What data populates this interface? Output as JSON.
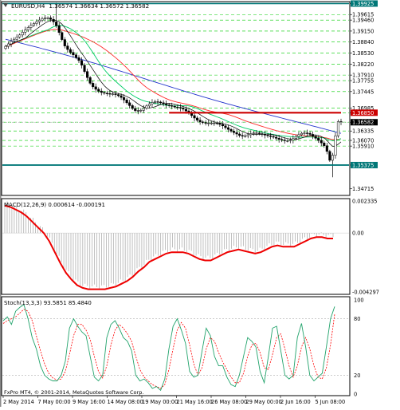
{
  "header": {
    "symbol_tf": "EURUSD,H4",
    "ohlc": "1.36574 1.36634 1.36572 1.36582"
  },
  "macd_label": "MACD(12,26,9) 0.000614 -0.000191",
  "stoch_label": "Stoch(13,3,3) 93.5851 85.4840",
  "footer": "FxPro MT4, © 2001-2014, MetaQuotes Software Corp.",
  "price_axis": {
    "ticks": [
      "1.39925",
      "1.39615",
      "1.39460",
      "1.39150",
      "1.38840",
      "1.38530",
      "1.38220",
      "1.37910",
      "1.37755",
      "1.37445",
      "1.36985",
      "1.36850",
      "1.36582",
      "1.36335",
      "1.36070",
      "1.35910",
      "1.35375",
      "1.34715"
    ]
  },
  "macd_axis": {
    "ticks": [
      "0.002335",
      "0.00",
      "-0.004297"
    ]
  },
  "stoch_axis": {
    "ticks": [
      "100",
      "80",
      "20",
      "0"
    ]
  },
  "time_axis": {
    "labels": [
      "2 May 2014",
      "7 May 00:00",
      "9 May 16:00",
      "14 May 08:00",
      "19 May 00:00",
      "21 May 16:00",
      "26 May 08:00",
      "29 May 00:00",
      "2 Jun 16:00",
      "5 Jun 08:00"
    ]
  },
  "levels": {
    "resistance": 1.3685,
    "support": 1.35375,
    "top": 1.39925
  },
  "colors": {
    "candle": "#000000",
    "ma_fast": "#000000",
    "ma_green": "#00cc66",
    "ma_red": "#ff2a2a",
    "ma_blue": "#2233cc",
    "resistance": "#cc0000",
    "support": "#007777",
    "grid_green": "#00cc00",
    "macd_signal": "#ee0000",
    "macd_hist": "#b0b0b0",
    "stoch_main": "#21a36b",
    "stoch_signal": "#ff0000"
  },
  "chart_data": [
    {
      "type": "candlestick",
      "title": "EURUSD,H4",
      "ylim": [
        1.3452,
        1.3998
      ],
      "x_labels": [
        "2 May 2014",
        "7 May 00:00",
        "9 May 16:00",
        "14 May 08:00",
        "19 May 00:00",
        "21 May 16:00",
        "26 May 08:00",
        "29 May 00:00",
        "2 Jun 16:00",
        "5 Jun 08:00"
      ],
      "close_approx": [
        1.3872,
        1.3879,
        1.3886,
        1.3892,
        1.3898,
        1.3904,
        1.3912,
        1.3918,
        1.3925,
        1.3931,
        1.3936,
        1.3941,
        1.3946,
        1.395,
        1.3952,
        1.3952,
        1.3948,
        1.3941,
        1.393,
        1.3911,
        1.3891,
        1.3873,
        1.3863,
        1.3855,
        1.3848,
        1.384,
        1.3832,
        1.3819,
        1.3801,
        1.3784,
        1.3768,
        1.3758,
        1.3751,
        1.3746,
        1.3742,
        1.374,
        1.3739,
        1.3738,
        1.3738,
        1.3736,
        1.3733,
        1.3728,
        1.3721,
        1.3713,
        1.3705,
        1.3697,
        1.3691,
        1.369,
        1.3692,
        1.3698,
        1.3704,
        1.371,
        1.3714,
        1.3716,
        1.3715,
        1.3713,
        1.371,
        1.3707,
        1.3705,
        1.3703,
        1.3701,
        1.37,
        1.3698,
        1.3695,
        1.369,
        1.3684,
        1.3677,
        1.367,
        1.3664,
        1.3659,
        1.3657,
        1.3656,
        1.3656,
        1.3656,
        1.3656,
        1.3655,
        1.3652,
        1.3648,
        1.3643,
        1.3638,
        1.3633,
        1.3629,
        1.3625,
        1.3621,
        1.3619,
        1.362,
        1.3623,
        1.3626,
        1.3628,
        1.3628,
        1.3626,
        1.3624,
        1.3622,
        1.362,
        1.3618,
        1.3616,
        1.3613,
        1.361,
        1.3608,
        1.3606,
        1.3606,
        1.3608,
        1.3612,
        1.3618,
        1.3623,
        1.3627,
        1.3628,
        1.3627,
        1.3624,
        1.3619,
        1.3613,
        1.3607,
        1.36,
        1.3592,
        1.3576,
        1.3551,
        1.3565,
        1.362,
        1.366,
        1.3658
      ]
    },
    {
      "type": "line",
      "title": "MACD(12,26,9)",
      "ylim": [
        -0.004297,
        0.002335
      ],
      "series": [
        {
          "values": [
            0.0022,
            0.0021,
            0.0019,
            0.0017,
            0.0014,
            0.001,
            0.0006,
            0.0002,
            -0.0004,
            -0.0012,
            -0.002,
            -0.0027,
            -0.0032,
            -0.0036,
            -0.0038,
            -0.0039,
            -0.0039,
            -0.0039,
            -0.0039,
            -0.0038,
            -0.0037,
            -0.0035,
            -0.0033,
            -0.003,
            -0.0026,
            -0.0023,
            -0.0019,
            -0.0017,
            -0.0015,
            -0.0013,
            -0.0012,
            -0.0012,
            -0.0012,
            -0.0013,
            -0.0015,
            -0.0017,
            -0.0018,
            -0.0018,
            -0.0016,
            -0.0014,
            -0.0012,
            -0.0011,
            -0.001,
            -0.0011,
            -0.0012,
            -0.0013,
            -0.0012,
            -0.001,
            -0.0008,
            -0.0007,
            -0.0008,
            -0.0008,
            -0.0008,
            -0.0006,
            -0.0004,
            -0.0002,
            -0.0001,
            -0.0001,
            -0.0002,
            -0.0002
          ]
        }
      ]
    },
    {
      "type": "line",
      "title": "Stoch(13,3,3)",
      "ylim": [
        0,
        100
      ],
      "series": [
        {
          "values": [
            78,
            82,
            74,
            88,
            92,
            95,
            80,
            60,
            48,
            30,
            20,
            16,
            14,
            14,
            20,
            35,
            70,
            80,
            72,
            66,
            62,
            40,
            18,
            14,
            20,
            60,
            74,
            78,
            70,
            60,
            56,
            46,
            20,
            14,
            16,
            12,
            6,
            8,
            4,
            16,
            48,
            72,
            80,
            68,
            54,
            24,
            18,
            20,
            46,
            70,
            62,
            40,
            30,
            30,
            18,
            10,
            8,
            20,
            40,
            60,
            56,
            50,
            24,
            12,
            40,
            70,
            72,
            46,
            20,
            16,
            20,
            60,
            75,
            50,
            20,
            14,
            18,
            22,
            50,
            80,
            93
          ]
        },
        {
          "values": [
            75,
            78,
            80,
            82,
            86,
            90,
            88,
            78,
            62,
            46,
            32,
            22,
            17,
            15,
            16,
            24,
            42,
            62,
            74,
            74,
            68,
            58,
            40,
            24,
            17,
            30,
            52,
            68,
            74,
            70,
            64,
            56,
            40,
            26,
            18,
            14,
            10,
            8,
            6,
            10,
            26,
            48,
            68,
            76,
            70,
            52,
            32,
            20,
            28,
            48,
            60,
            56,
            44,
            34,
            26,
            18,
            12,
            12,
            22,
            40,
            52,
            54,
            44,
            28,
            26,
            42,
            60,
            64,
            48,
            30,
            18,
            30,
            50,
            60,
            48,
            30,
            18,
            16,
            28,
            52,
            85
          ]
        }
      ]
    }
  ]
}
